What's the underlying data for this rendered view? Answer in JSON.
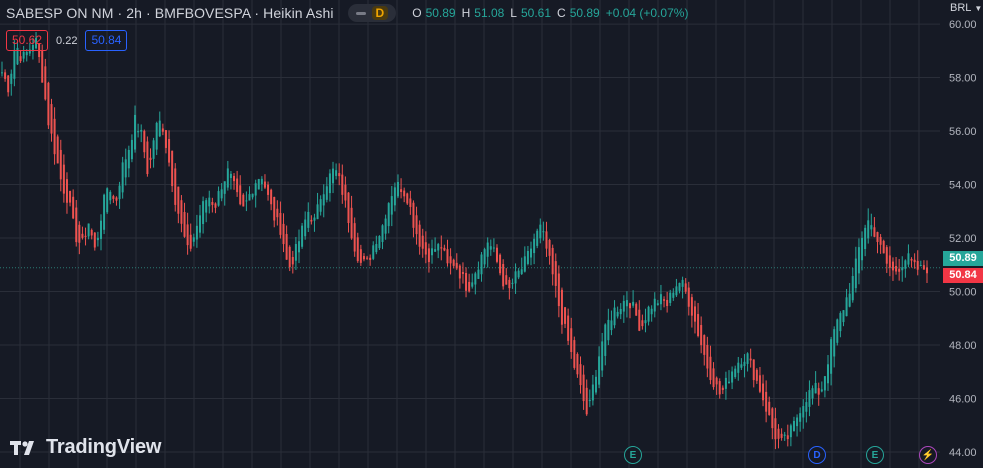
{
  "header": {
    "title": "SABESP ON NM · 2h · BMFBOVESPA · Heikin Ashi",
    "badge": "D",
    "ohlc": {
      "o_label": "O",
      "o": "50.89",
      "h_label": "H",
      "h": "51.08",
      "l_label": "L",
      "l": "50.61",
      "c_label": "C",
      "c": "50.89",
      "change": "+0.04 (+0.07%)"
    }
  },
  "trade": {
    "sell": "50.62",
    "spread": "0.22",
    "buy": "50.84"
  },
  "currency": "BRL",
  "price_tags": {
    "last": "50.89",
    "bid": "50.84"
  },
  "branding": {
    "logo_text": "TradingView"
  },
  "events": [
    {
      "label": "E",
      "kind": "earnings"
    },
    {
      "label": "D",
      "kind": "dividend"
    },
    {
      "label": "E",
      "kind": "earnings"
    },
    {
      "label": "⚡",
      "kind": "split"
    }
  ],
  "colors": {
    "up": "#26a69a",
    "down": "#ef5350",
    "background": "#161a25",
    "grid": "#2a2e39"
  },
  "chart_data": {
    "type": "candlestick",
    "style": "Heikin Ashi",
    "interval": "2h",
    "ylim": [
      43.4,
      60.9
    ],
    "y_ticks": [
      "60.00",
      "58.00",
      "56.00",
      "54.00",
      "52.00",
      "50.00",
      "48.00",
      "46.00",
      "44.00"
    ],
    "last_price_line": 50.89,
    "close_path": [
      58.2,
      57.6,
      59.3,
      58.7,
      59.0,
      59.5,
      58.1,
      56.3,
      55.2,
      54.0,
      53.4,
      52.1,
      51.7,
      52.6,
      51.5,
      53.0,
      54.1,
      53.2,
      54.6,
      55.3,
      56.4,
      55.8,
      54.3,
      56.1,
      56.4,
      55.0,
      53.5,
      52.4,
      51.4,
      52.2,
      53.1,
      53.6,
      53.2,
      54.0,
      54.5,
      53.8,
      52.9,
      53.5,
      54.1,
      54.4,
      53.5,
      52.7,
      52.3,
      50.8,
      51.4,
      52.2,
      53.0,
      52.6,
      53.7,
      54.2,
      54.6,
      53.9,
      52.8,
      51.7,
      51.0,
      51.1,
      51.9,
      52.3,
      53.3,
      54.0,
      53.9,
      53.5,
      52.4,
      51.7,
      51.3,
      51.6,
      51.7,
      50.9,
      51.1,
      50.6,
      50.1,
      50.7,
      51.3,
      51.9,
      51.4,
      50.6,
      49.9,
      50.5,
      50.8,
      51.3,
      52.0,
      52.4,
      51.4,
      50.3,
      49.1,
      48.2,
      47.2,
      46.3,
      45.3,
      46.7,
      48.0,
      48.8,
      49.3,
      49.5,
      49.8,
      49.3,
      48.6,
      49.3,
      49.6,
      49.7,
      49.5,
      50.2,
      50.4,
      49.8,
      49.0,
      48.1,
      47.2,
      46.6,
      46.1,
      46.7,
      47.2,
      47.5,
      47.6,
      46.9,
      46.3,
      45.5,
      44.7,
      44.3,
      44.5,
      45.0,
      45.7,
      46.1,
      46.4,
      46.2,
      47.3,
      48.5,
      49.1,
      49.8,
      50.6,
      51.9,
      52.7,
      52.3,
      51.6,
      51.0,
      50.7,
      51.0,
      51.3,
      50.9,
      50.8,
      50.89
    ]
  }
}
